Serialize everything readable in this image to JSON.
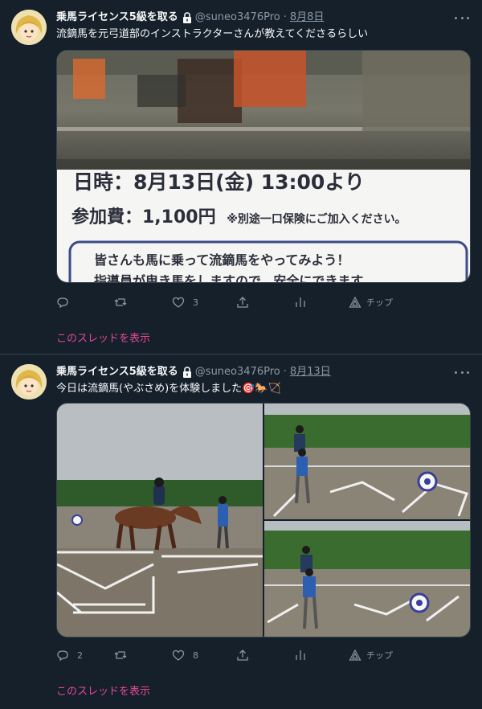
{
  "tweets": [
    {
      "name": "乗馬ライセンス5級を取る",
      "handle": "@suneo3476Pro",
      "separator": "·",
      "date": "8月8日",
      "text": "流鏑馬を元弓道部のインストラクターさんが教えてくださるらしい",
      "flyer": {
        "line1": "日時：8月13日(金) 13:00より",
        "line2_main": "参加費：1,100円",
        "line2_note": "※別途一口保険にご加入ください。",
        "box_line1": "皆さんも馬に乗って流鏑馬をやってみよう！",
        "box_line2": "指導員が曳き馬をしますので、安全にできます"
      },
      "actions": {
        "reply": "",
        "retweet": "",
        "like": "3",
        "tip": "チップ"
      },
      "show_thread": "このスレッドを表示"
    },
    {
      "name": "乗馬ライセンス5級を取る",
      "handle": "@suneo3476Pro",
      "separator": "·",
      "date": "8月13日",
      "text": "今日は流鏑馬(やぶさめ)を体験しました🎯🐎🏹",
      "actions": {
        "reply": "2",
        "retweet": "",
        "like": "8",
        "tip": "チップ"
      },
      "show_thread": "このスレッドを表示"
    }
  ],
  "colors": {
    "background": "#15202b",
    "secondary_text": "#8b98a5",
    "thread_link": "#e8479a",
    "divider": "#38444d"
  },
  "icons": [
    "lock-icon",
    "more-icon",
    "reply-icon",
    "retweet-icon",
    "like-icon",
    "share-icon",
    "stats-icon",
    "tip-icon"
  ]
}
